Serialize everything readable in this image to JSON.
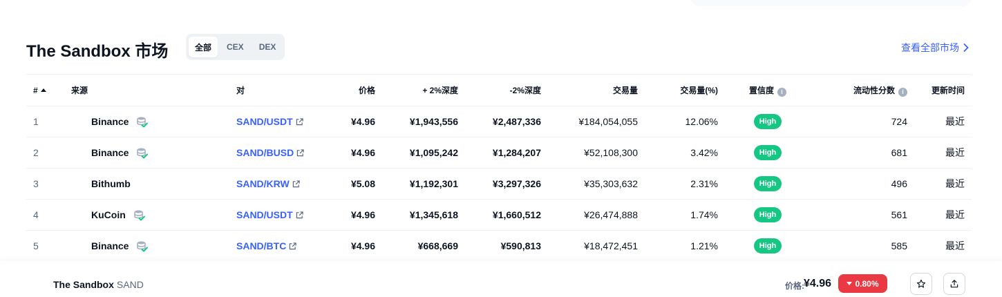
{
  "header": {
    "title": "The Sandbox 市场",
    "tabs": [
      {
        "label": "全部",
        "active": true
      },
      {
        "label": "CEX",
        "active": false
      },
      {
        "label": "DEX",
        "active": false
      }
    ],
    "view_all": "查看全部市场"
  },
  "table": {
    "columns": {
      "num": "#",
      "source": "来源",
      "pair": "对",
      "price": "价格",
      "depth_plus": "+ 2%深度",
      "depth_minus": "-2%深度",
      "volume": "交易量",
      "volume_pct": "交易量(%)",
      "confidence": "置信度",
      "liquidity": "流动性分数",
      "updated": "更新时间"
    },
    "rows": [
      {
        "num": "1",
        "source": "Binance",
        "verified": true,
        "pair": "SAND/USDT",
        "price": "¥4.96",
        "depth_plus": "¥1,943,556",
        "depth_minus": "¥2,487,336",
        "volume": "¥184,054,055",
        "volume_pct": "12.06%",
        "confidence": "High",
        "liquidity": "724",
        "updated": "最近"
      },
      {
        "num": "2",
        "source": "Binance",
        "verified": true,
        "pair": "SAND/BUSD",
        "price": "¥4.96",
        "depth_plus": "¥1,095,242",
        "depth_minus": "¥1,284,207",
        "volume": "¥52,108,300",
        "volume_pct": "3.42%",
        "confidence": "High",
        "liquidity": "681",
        "updated": "最近"
      },
      {
        "num": "3",
        "source": "Bithumb",
        "verified": false,
        "pair": "SAND/KRW",
        "price": "¥5.08",
        "depth_plus": "¥1,192,301",
        "depth_minus": "¥3,297,326",
        "volume": "¥35,303,632",
        "volume_pct": "2.31%",
        "confidence": "High",
        "liquidity": "496",
        "updated": "最近"
      },
      {
        "num": "4",
        "source": "KuCoin",
        "verified": true,
        "pair": "SAND/USDT",
        "price": "¥4.96",
        "depth_plus": "¥1,345,618",
        "depth_minus": "¥1,660,512",
        "volume": "¥26,474,888",
        "volume_pct": "1.74%",
        "confidence": "High",
        "liquidity": "561",
        "updated": "最近"
      },
      {
        "num": "5",
        "source": "Binance",
        "verified": true,
        "pair": "SAND/BTC",
        "price": "¥4.96",
        "depth_plus": "¥668,669",
        "depth_minus": "¥590,813",
        "volume": "¥18,472,451",
        "volume_pct": "1.21%",
        "confidence": "High",
        "liquidity": "585",
        "updated": "最近"
      }
    ]
  },
  "bottom_bar": {
    "coin_name": "The Sandbox",
    "coin_symbol": "SAND",
    "price_label": "价格:",
    "price": "¥4.96",
    "change": "0.80%",
    "change_direction": "down"
  },
  "colors": {
    "accent": "#3861fb",
    "confidence_high": "#16c784",
    "negative": "#ea3943",
    "text_primary": "#0d1421",
    "text_secondary": "#58667e"
  },
  "icons": {
    "sort": "sort-ascending-icon",
    "info": "info-icon",
    "verified": "verified-database-icon",
    "external_link": "external-link-icon",
    "chevron": "chevron-right-icon",
    "star": "star-icon",
    "share": "share-icon"
  }
}
